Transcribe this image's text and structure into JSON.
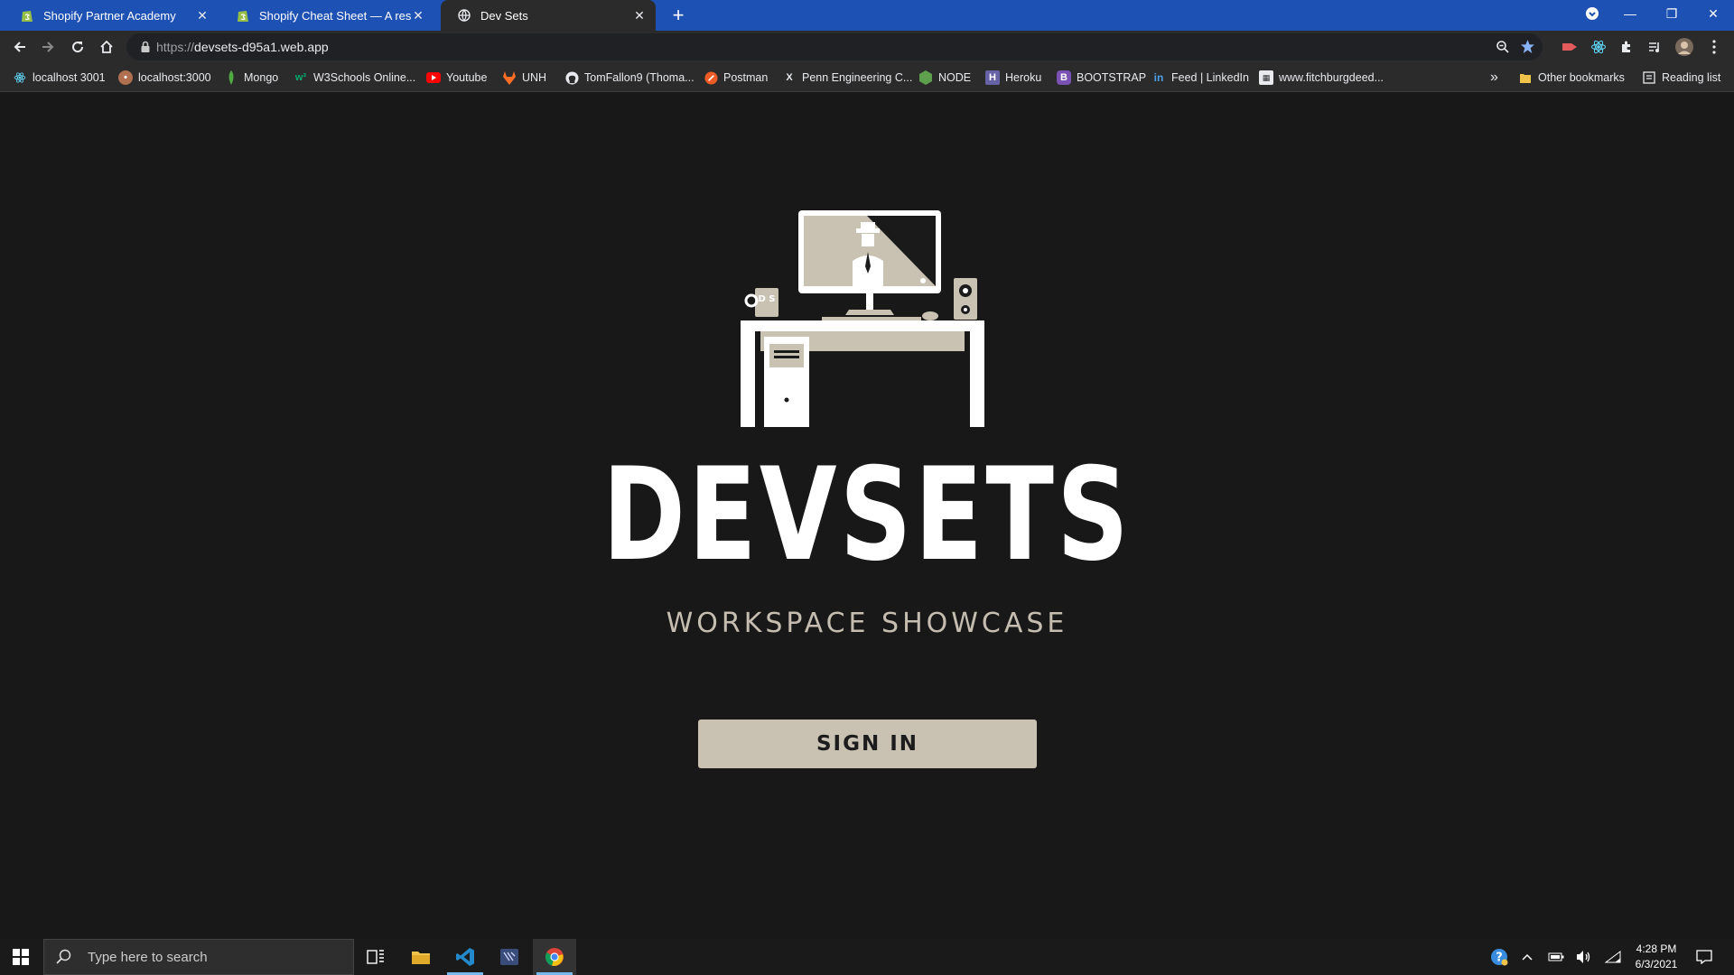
{
  "browser": {
    "tabs": [
      {
        "label": "Shopify Partner Academy",
        "icon": "shopify-icon",
        "close": "✕"
      },
      {
        "label": "Shopify Cheat Sheet — A resource",
        "icon": "shopify-icon",
        "close": "✕"
      },
      {
        "label": "Dev Sets",
        "icon": "globe-icon",
        "close": "✕"
      }
    ],
    "new_tab": "+",
    "window_controls": {
      "minimize": "—",
      "restore": "❐",
      "close": "✕"
    },
    "address": {
      "scheme": "https://",
      "host": "devsets-d95a1.web.app"
    },
    "bookmarks": [
      {
        "label": "localhost 3001",
        "icon": "react-icon"
      },
      {
        "label": "localhost:3000",
        "icon": "app-icon"
      },
      {
        "label": "Mongo",
        "icon": "mongo-leaf-icon"
      },
      {
        "label": "W3Schools Online...",
        "icon": "w3schools-icon"
      },
      {
        "label": "Youtube",
        "icon": "youtube-icon"
      },
      {
        "label": "UNH",
        "icon": "gitlab-icon"
      },
      {
        "label": "TomFallon9 (Thoma...",
        "icon": "github-icon"
      },
      {
        "label": "Postman",
        "icon": "postman-icon"
      },
      {
        "label": "Penn Engineering C...",
        "icon": "x-icon"
      },
      {
        "label": "NODE",
        "icon": "node-icon"
      },
      {
        "label": "Heroku",
        "icon": "heroku-icon"
      },
      {
        "label": "BOOTSTRAP",
        "icon": "bootstrap-icon"
      },
      {
        "label": "Feed | LinkedIn",
        "icon": "linkedin-icon"
      },
      {
        "label": "www.fitchburgdeed...",
        "icon": "site-icon"
      }
    ],
    "bookmarks_overflow": "»",
    "other_bookmarks": "Other bookmarks",
    "reading_list": "Reading list"
  },
  "page": {
    "logo_monogram": "D S",
    "brand": "DEVSETS",
    "tagline": "WORKSPACE SHOWCASE",
    "sign_in_label": "SIGN IN",
    "colors": {
      "background": "#181818",
      "accent": "#c9c2b3"
    }
  },
  "taskbar": {
    "search_placeholder": "Type here to search",
    "time": "4:28 PM",
    "date": "6/3/2021"
  }
}
